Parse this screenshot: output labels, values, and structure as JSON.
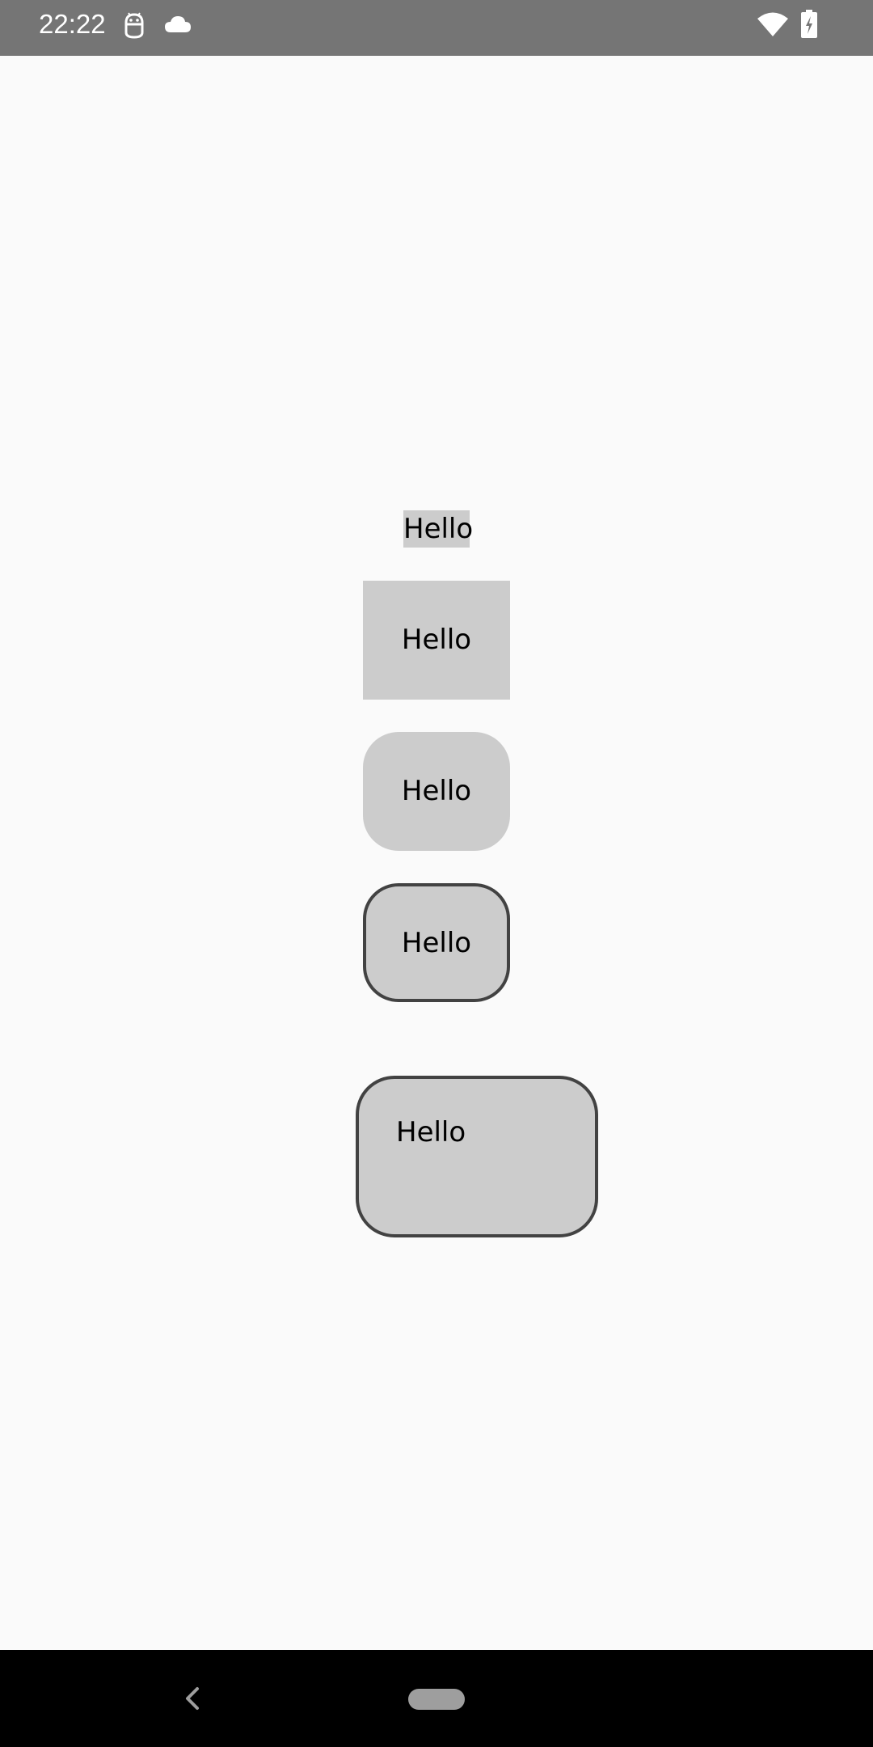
{
  "status_bar": {
    "time": "22:22",
    "icons": [
      "android-debug-icon",
      "cloud-icon",
      "wifi-icon",
      "battery-charging-icon"
    ],
    "background_color": "#757575"
  },
  "boxes": [
    {
      "label": "Hello",
      "style": "plain"
    },
    {
      "label": "Hello",
      "style": "padded"
    },
    {
      "label": "Hello",
      "style": "rounded"
    },
    {
      "label": "Hello",
      "style": "rounded-bordered"
    },
    {
      "label": "Hello",
      "style": "wide-rounded-bordered"
    }
  ],
  "colors": {
    "page_background": "#fafafa",
    "box_fill": "#cccccc",
    "box_border": "#424242",
    "text": "#000000"
  },
  "nav_bar": {
    "icons": [
      "back-icon",
      "home-pill-icon"
    ]
  }
}
